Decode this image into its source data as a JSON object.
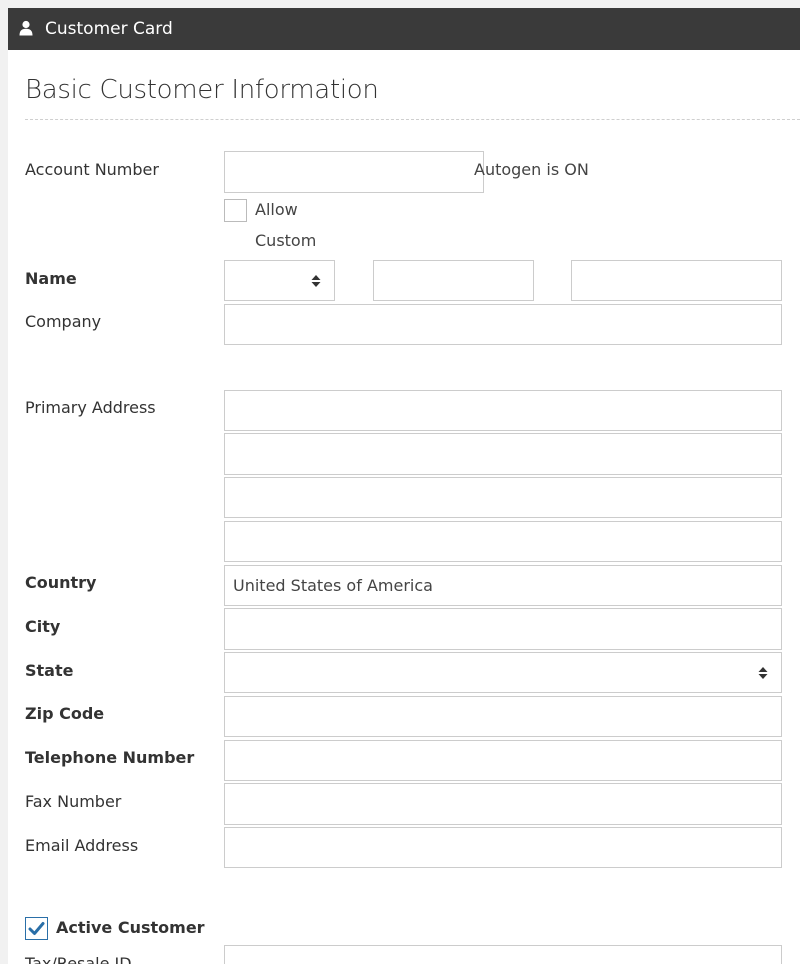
{
  "header": {
    "title": "Customer Card",
    "icon": "user-icon"
  },
  "section": {
    "title": "Basic Customer Information"
  },
  "account": {
    "label": "Account Number",
    "value": "",
    "autogen_text": "Autogen is ON",
    "allow_custom_line1": "Allow",
    "allow_custom_line2": "Custom",
    "allow_custom_checked": false
  },
  "name": {
    "label": "Name",
    "prefix_value": "",
    "first_value": "",
    "last_value": ""
  },
  "company": {
    "label": "Company",
    "value": ""
  },
  "primary_address": {
    "label": "Primary Address",
    "lines": [
      "",
      "",
      "",
      ""
    ]
  },
  "country": {
    "label": "Country",
    "value": "United States of America"
  },
  "city": {
    "label": "City",
    "value": ""
  },
  "state": {
    "label": "State",
    "value": ""
  },
  "zip": {
    "label": "Zip Code",
    "value": ""
  },
  "telephone": {
    "label": "Telephone Number",
    "value": ""
  },
  "fax": {
    "label": "Fax Number",
    "value": ""
  },
  "email": {
    "label": "Email Address",
    "value": ""
  },
  "active_customer": {
    "label": "Active Customer",
    "checked": true
  },
  "tax_resale": {
    "label": "Tax/Resale ID",
    "value": ""
  },
  "colors": {
    "header_bg": "#3a3a3a",
    "border": "#cccccc",
    "check_blue": "#2a6fa8"
  }
}
